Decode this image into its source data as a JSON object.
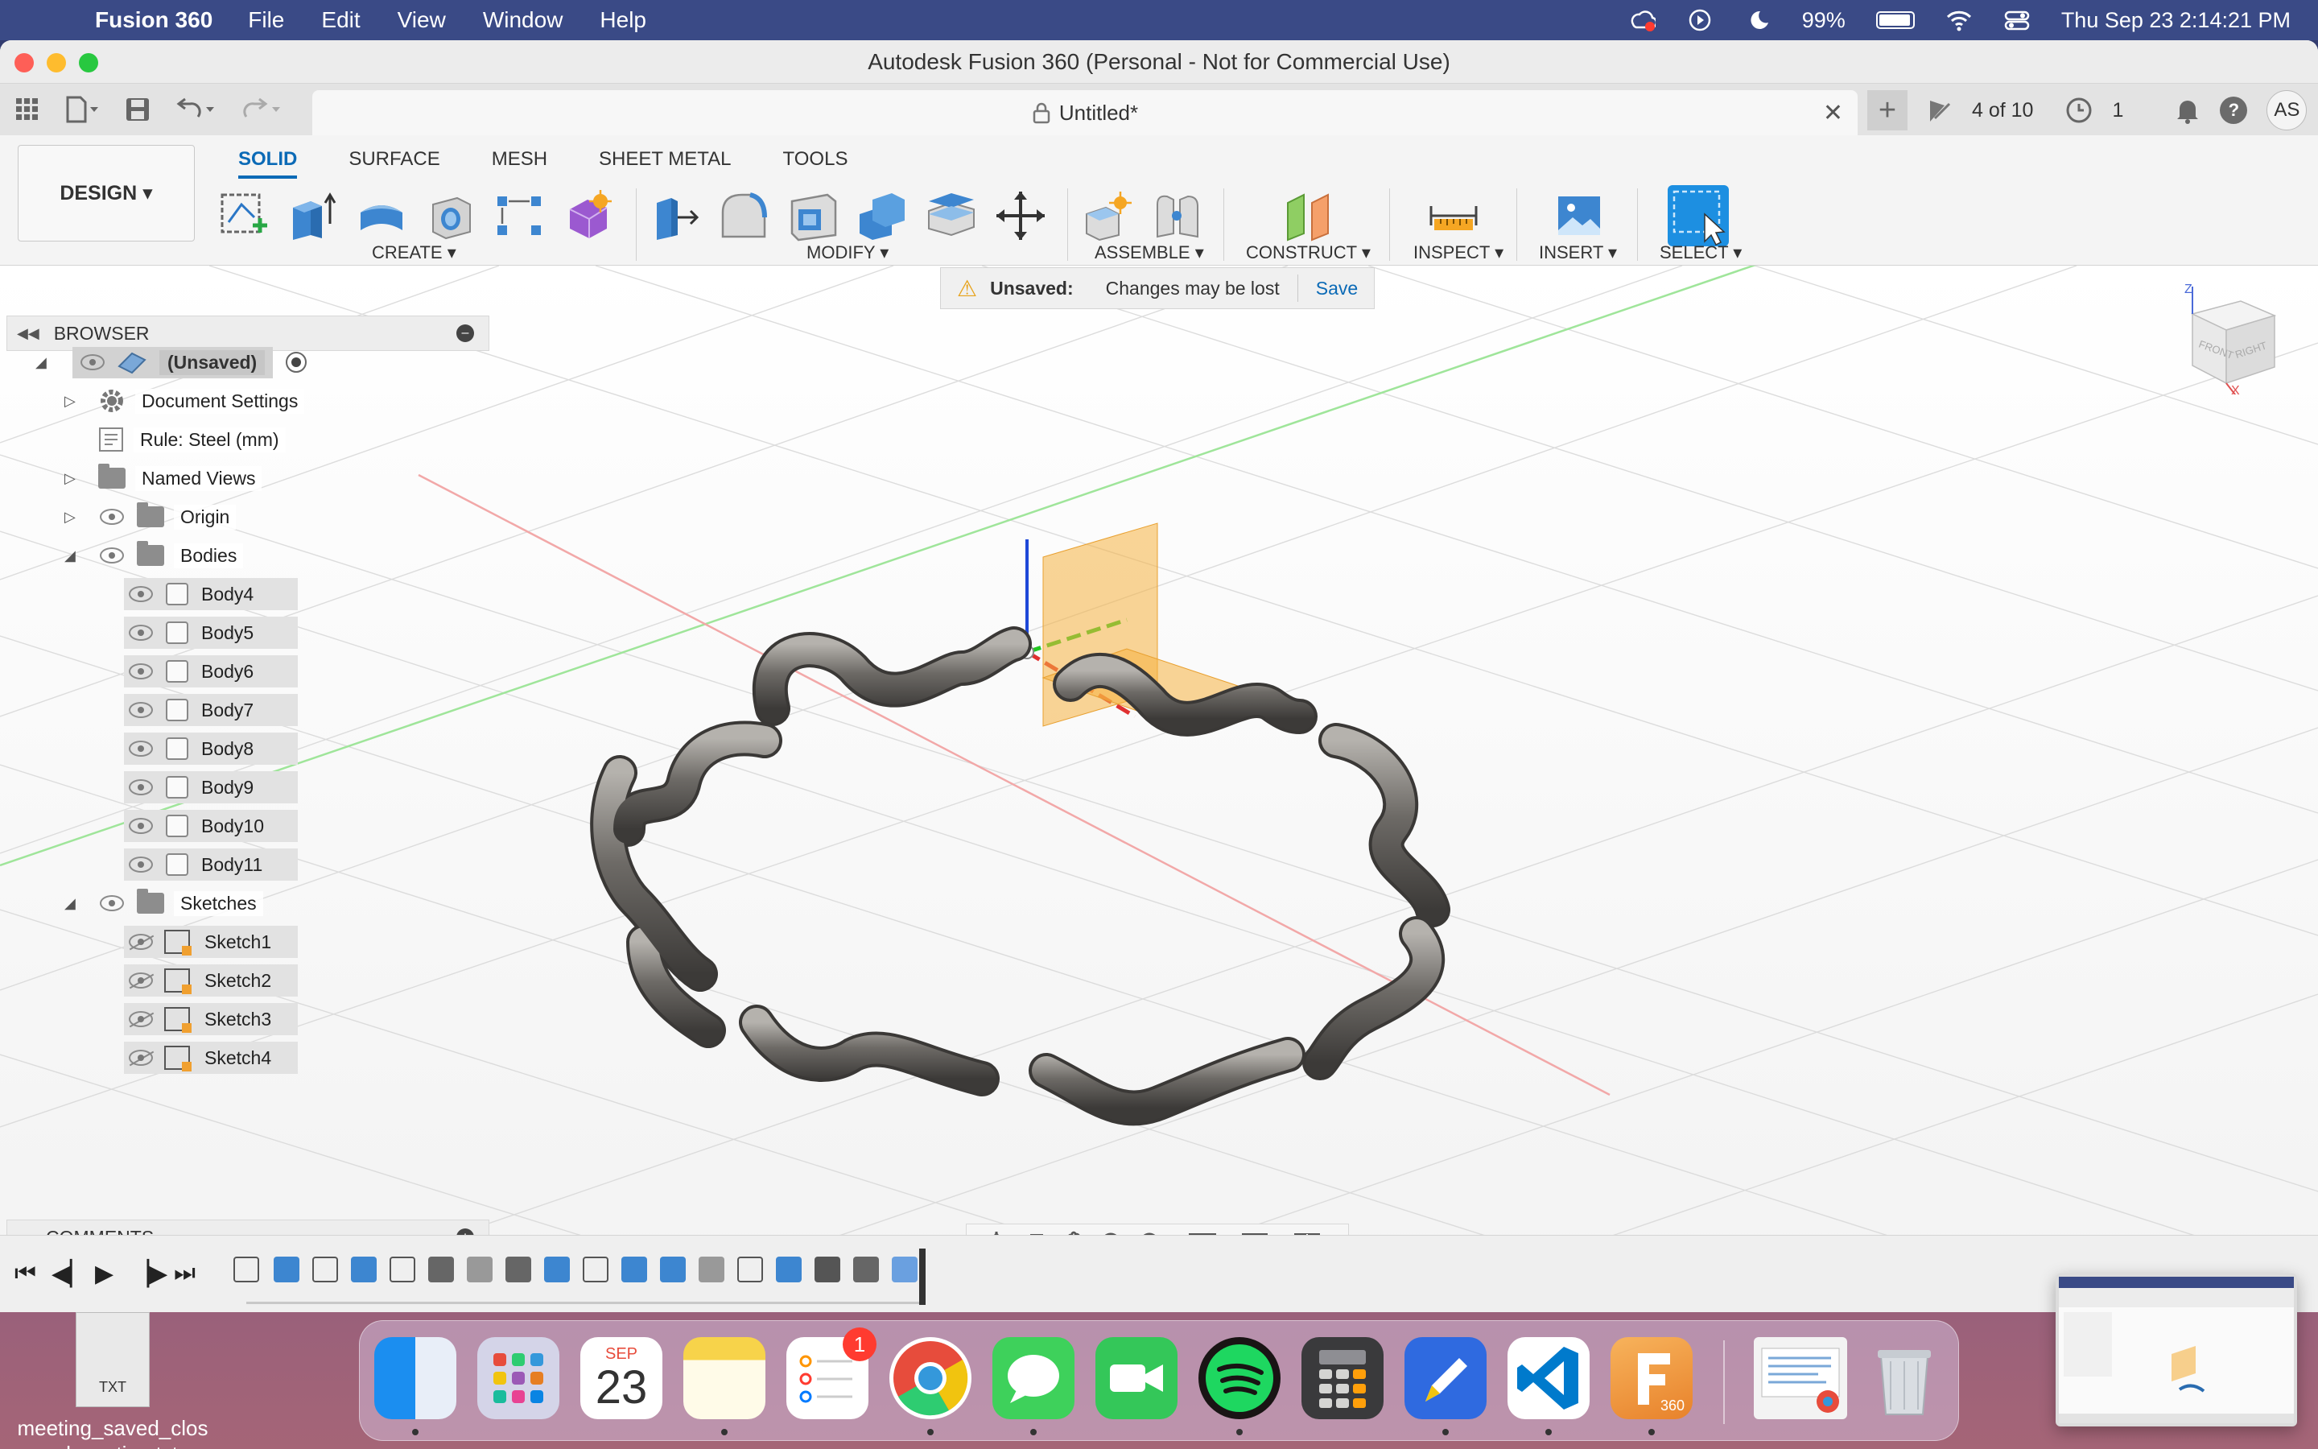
{
  "menubar": {
    "app_name": "Fusion 360",
    "items": [
      "File",
      "Edit",
      "View",
      "Window",
      "Help"
    ],
    "battery": "99%",
    "clock": "Thu Sep 23  2:14:21 PM"
  },
  "window": {
    "title": "Autodesk Fusion 360 (Personal - Not for Commercial Use)",
    "doc_tab": "Untitled*",
    "jobs_label": "4 of 10",
    "clock_count": "1",
    "user_initials": "AS"
  },
  "ribbon": {
    "workspace": "DESIGN ▾",
    "tabs": [
      "SOLID",
      "SURFACE",
      "MESH",
      "SHEET METAL",
      "TOOLS"
    ],
    "groups": {
      "create": "CREATE ▾",
      "modify": "MODIFY ▾",
      "assemble": "ASSEMBLE ▾",
      "construct": "CONSTRUCT ▾",
      "inspect": "INSPECT ▾",
      "insert": "INSERT ▾",
      "select": "SELECT ▾"
    }
  },
  "browser": {
    "title": "BROWSER",
    "root": "(Unsaved)",
    "document_settings": "Document Settings",
    "rule": "Rule: Steel (mm)",
    "named_views": "Named Views",
    "origin": "Origin",
    "bodies_folder": "Bodies",
    "bodies": [
      "Body4",
      "Body5",
      "Body6",
      "Body7",
      "Body8",
      "Body9",
      "Body10",
      "Body11"
    ],
    "sketches_folder": "Sketches",
    "sketches": [
      "Sketch1",
      "Sketch2",
      "Sketch3",
      "Sketch4"
    ]
  },
  "notification": {
    "label": "Unsaved:",
    "message": "Changes may be lost",
    "action": "Save"
  },
  "viewcube": {
    "z": "Z",
    "x": "X",
    "front": "FRONT",
    "right": "RIGHT"
  },
  "comments": {
    "title": "COMMENTS"
  },
  "desktop": {
    "file_name": "meeting_saved_closed_caption.txt",
    "file_type": "TXT"
  },
  "dock": {
    "calendar_month": "SEP",
    "calendar_day": "23",
    "reminders_badge": "1",
    "fusion_label": "360"
  },
  "colors": {
    "accent": "#0b6ab6",
    "menubar": "#3a4a86",
    "construct_plane": "#f5b342"
  }
}
